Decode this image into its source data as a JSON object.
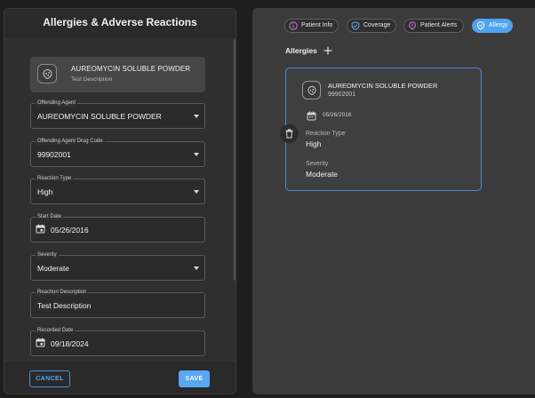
{
  "dialog": {
    "title": "Allergies & Adverse Reactions",
    "summary": {
      "name": "AUREOMYCIN SOLUBLE POWDER",
      "description": "Test Description"
    },
    "fields": {
      "offending_agent": {
        "label": "Offending Agent",
        "value": "AUREOMYCIN SOLUBLE POWDER"
      },
      "drug_code": {
        "label": "Offending Agent Drug Code",
        "value": "99902001"
      },
      "reaction_type": {
        "label": "Reaction Type",
        "value": "High"
      },
      "start_date": {
        "label": "Start Date",
        "value": "05/26/2016"
      },
      "severity": {
        "label": "Severity",
        "value": "Moderate"
      },
      "reaction_description": {
        "label": "Reaction Description",
        "value": "Test Description"
      },
      "recorded_date": {
        "label": "Recorded Date",
        "value": "09/18/2024"
      }
    },
    "cancel_label": "CANCEL",
    "save_label": "SAVE"
  },
  "tabs": [
    {
      "label": "Patient Info",
      "icon": "info-icon"
    },
    {
      "label": "Coverage",
      "icon": "shield-icon"
    },
    {
      "label": "Patient Alerts",
      "icon": "alert-pin-icon"
    },
    {
      "label": "Allergy",
      "icon": "allergy-icon",
      "active": true
    }
  ],
  "allergies": {
    "title": "Allergies",
    "card": {
      "name": "AUREOMYCIN SOLUBLE POWDER",
      "code": "99902001",
      "date": "05/26/2016",
      "reaction_type_label": "Reaction Type",
      "reaction_type": "High",
      "severity_label": "Severity",
      "severity": "Moderate"
    }
  },
  "colors": {
    "accent": "#58a7f3",
    "card_border": "#4a8fd6",
    "tab_active": "#4fa3ef"
  }
}
